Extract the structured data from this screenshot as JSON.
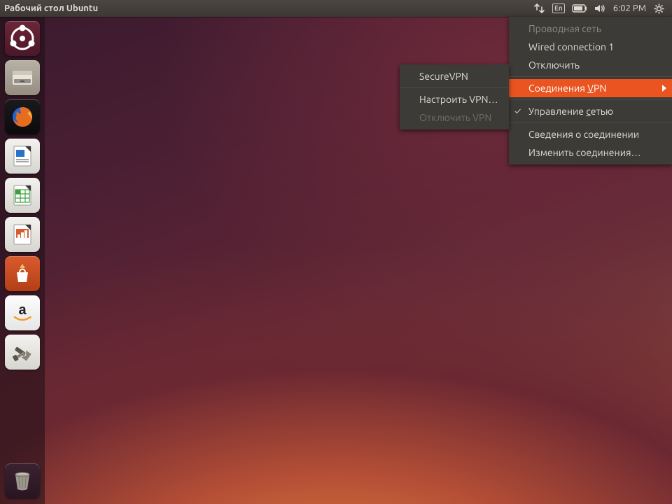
{
  "topbar": {
    "title": "Рабочий стол Ubuntu",
    "lang": "En",
    "clock": "6:02 PM"
  },
  "launcher": {
    "items": [
      {
        "name": "dash",
        "label": "Dash"
      },
      {
        "name": "files",
        "label": "Files"
      },
      {
        "name": "firefox",
        "label": "Firefox"
      },
      {
        "name": "writer",
        "label": "LibreOffice Writer"
      },
      {
        "name": "calc",
        "label": "LibreOffice Calc"
      },
      {
        "name": "impress",
        "label": "LibreOffice Impress"
      },
      {
        "name": "software",
        "label": "Ubuntu Software"
      },
      {
        "name": "amazon",
        "label": "Amazon"
      },
      {
        "name": "settings",
        "label": "System Settings"
      }
    ],
    "trash": "Trash"
  },
  "network_menu": {
    "header": "Проводная сеть",
    "wired": "Wired connection 1",
    "disconnect": "Отключить",
    "vpn": "Соединения ",
    "vpn_u": "V",
    "vpn_tail": "PN",
    "manage_pre": "Управление ",
    "manage_u": "с",
    "manage_tail": "етью",
    "info": "Сведения о соединении",
    "edit": "Изменить соединения…"
  },
  "vpn_submenu": {
    "secure": "SecureVPN",
    "configure": "Настроить VPN…",
    "disconnect": "Отключить VPN"
  },
  "colors": {
    "accent": "#e95420",
    "panel": "#3c3b37"
  }
}
